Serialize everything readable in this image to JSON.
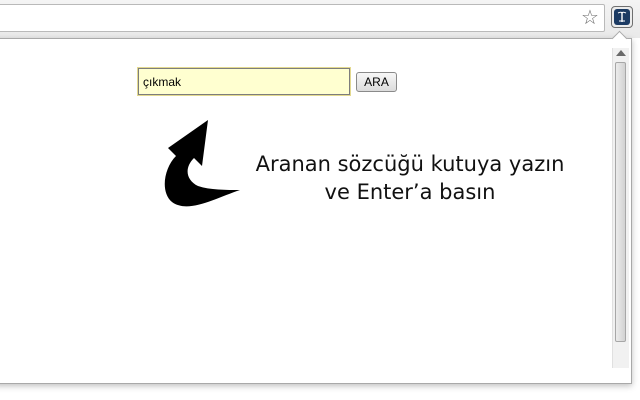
{
  "browser": {
    "bookmark_icon": "star-icon",
    "extension_icon": "dictionary-extension-icon"
  },
  "popup": {
    "search": {
      "value": "çıkmak",
      "button_label": "ARA"
    },
    "hint": {
      "arrow_icon": "curved-arrow-icon",
      "line1": "Aranan sözcüğü kutuya yazın",
      "line2": "ve Enter’a basın"
    }
  },
  "colors": {
    "input_background": "#ffffd0",
    "extension_icon": "#1c3b63"
  }
}
